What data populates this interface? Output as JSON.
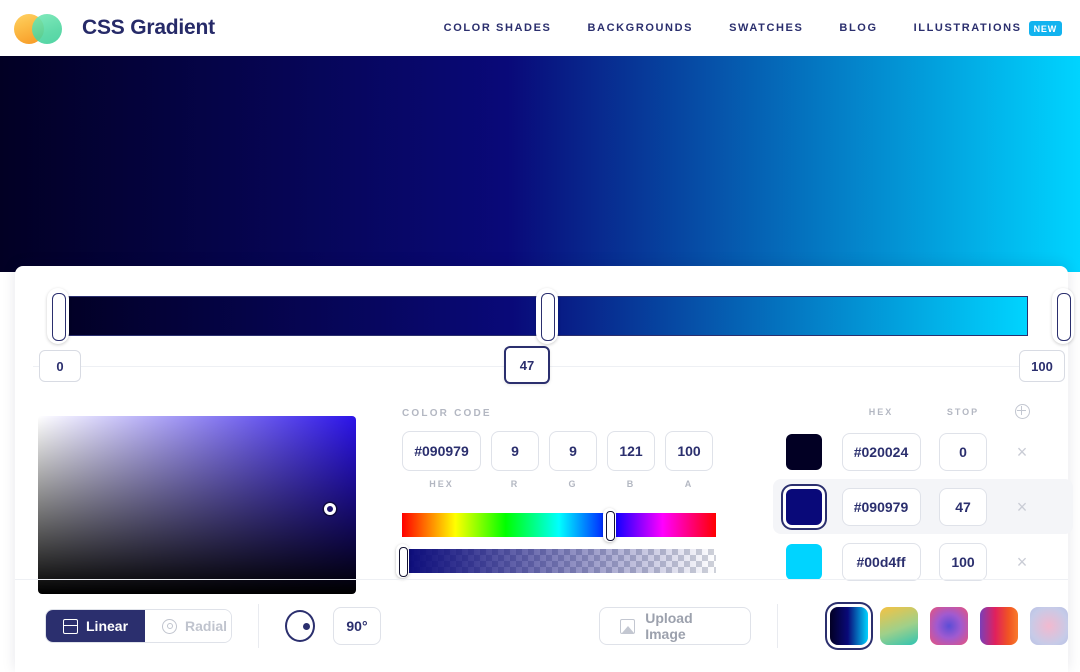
{
  "header": {
    "brand": "CSS Gradient",
    "logo_left_color": "#f7a824",
    "logo_right_color": "#4fd6a0",
    "nav": [
      {
        "label": "COLOR SHADES"
      },
      {
        "label": "BACKGROUNDS"
      },
      {
        "label": "SWATCHES"
      },
      {
        "label": "BLOG"
      },
      {
        "label": "ILLUSTRATIONS",
        "badge": "NEW"
      }
    ]
  },
  "hero": {
    "gradient_css": "linear-gradient(90deg, #020024 0%, #090979 47%, #00d4ff 100%)"
  },
  "slider": {
    "handles": [
      {
        "position": 0,
        "value": "0"
      },
      {
        "position": 47,
        "value": "47"
      },
      {
        "position": 100,
        "value": "100"
      }
    ]
  },
  "color_code": {
    "label": "COLOR CODE",
    "hex": {
      "value": "#090979",
      "caption": "HEX"
    },
    "r": {
      "value": "9",
      "caption": "R"
    },
    "g": {
      "value": "9",
      "caption": "G"
    },
    "b": {
      "value": "121",
      "caption": "B"
    },
    "a": {
      "value": "100",
      "caption": "A"
    }
  },
  "stop_list": {
    "headers": {
      "swatch": "",
      "hex": "HEX",
      "stop": "STOP",
      "add": "add-stop"
    },
    "rows": [
      {
        "color": "#020024",
        "hex": "#020024",
        "stop": "0",
        "selected": false,
        "remove": "×"
      },
      {
        "color": "#090979",
        "hex": "#090979",
        "stop": "47",
        "selected": true,
        "remove": "×"
      },
      {
        "color": "#00d4ff",
        "hex": "#00d4ff",
        "stop": "100",
        "selected": false,
        "remove": "×"
      }
    ]
  },
  "toolbar": {
    "linear_label": "Linear",
    "radial_label": "Radial",
    "active_type": "Linear",
    "angle": "90°",
    "upload_label": "Upload Image",
    "presets": [
      {
        "name": "navy-cyan",
        "css": "linear-gradient(90deg,#020024 0%,#090979 47%,#00d4ff 100%)",
        "selected": true
      },
      {
        "name": "yellow-teal",
        "css": "linear-gradient(160deg,#f5c243 0%,#9fd08a 55%,#2fc4b2 100%)",
        "selected": false
      },
      {
        "name": "pink-purple-radial",
        "css": "radial-gradient(circle at 50% 50%,#5b4dd6 0%,#a05ad0 45%,#e8547c 100%)",
        "selected": false
      },
      {
        "name": "magenta-orange",
        "css": "linear-gradient(90deg,#7a3fb8 0%,#e0205e 40%,#f05423 75%,#f97b2c 100%)",
        "selected": false
      },
      {
        "name": "lavender-pink-soft",
        "css": "radial-gradient(circle at 50% 50%,#f2b9cf 0%,#c6cbe8 70%,#b9c0e4 100%)",
        "selected": false
      }
    ]
  },
  "colors": {
    "brand_navy": "#2b2f6e",
    "accent_cyan": "#12b3ef",
    "stop_1": "#020024",
    "stop_2": "#090979",
    "stop_3": "#00d4ff"
  }
}
